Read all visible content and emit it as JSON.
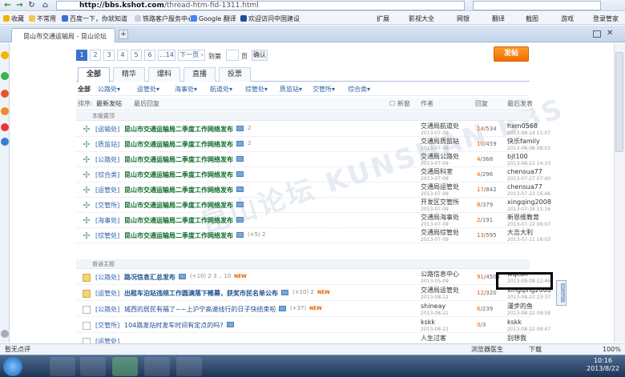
{
  "browser": {
    "url_host": "http://bbs.kshot.com",
    "url_path": "/thread-htm-fid-1311.html",
    "toolbar_right": [
      "扩展",
      "影视大全",
      "网银",
      "翻译",
      "截图",
      "游戏",
      "登录管家"
    ],
    "bookmarks": [
      "收藏",
      "不常用",
      "百度一下，你就知道",
      "铁路客户服务中心",
      "Google 翻译",
      "欢迎访问中国建设"
    ],
    "tab_title": "昆山市交通运输局 - 昆山论坛"
  },
  "pager": {
    "pages": [
      "1",
      "2",
      "3",
      "4",
      "5",
      "6",
      "...14",
      "下一页 ›"
    ],
    "goto_label": "到第",
    "page_suffix": "页",
    "confirm": "确认"
  },
  "post_button": "发帖",
  "tabs": [
    "全部",
    "精华",
    "爆料",
    "直播",
    "投票"
  ],
  "categories": [
    "全部",
    "公路处▾",
    "运管处▾",
    "海事处▾",
    "航道处▾",
    "综管处▾",
    "质监站▾",
    "交管所▾",
    "综合类▾"
  ],
  "list_header": {
    "sort": "排序:",
    "latest_post": "最新发帖",
    "latest_reply": "最后回复",
    "new_window": "新窗",
    "author": "作者",
    "replies": "回复",
    "last_post": "最后发表"
  },
  "sections": {
    "top": "本版置顶",
    "normal": "普通主题"
  },
  "rows": [
    {
      "forum": "[运输处]",
      "title": "昆山市交通运输局二季度工作网络发布",
      "extra": "2",
      "author": "交通局航道处",
      "adate": "2013-07-09",
      "rp": "14",
      "views": "/534",
      "last": "hxm0568",
      "ldate": "2013-08-14 15:07",
      "icon": "pin"
    },
    {
      "forum": "[质监站]",
      "title": "昆山市交通运输局二季度工作网络发布",
      "extra": "2",
      "author": "交通局质监站",
      "adate": "2013-07-09",
      "rp": "10",
      "views": "/459",
      "last": "快乐family",
      "ldate": "2013-08-08 08:01",
      "icon": "pin"
    },
    {
      "forum": "[公路处]",
      "title": "昆山市交通运输局二季度工作网络发布",
      "extra": "",
      "author": "交通局公路处",
      "adate": "2013-07-09",
      "rp": "4",
      "views": "/368",
      "last": "bjt100",
      "ldate": "2013-08-22 14:33",
      "icon": "pin"
    },
    {
      "forum": "[综合类]",
      "title": "昆山市交通运输局二季度工作网络发布",
      "extra": "",
      "author": "交通局科室",
      "adate": "2013-07-09",
      "rp": "4",
      "views": "/296",
      "last": "chensua77",
      "ldate": "2013-07-27 07:40",
      "icon": "pin"
    },
    {
      "forum": "[运管处]",
      "title": "昆山市交通运输局二季度工作网络发布",
      "extra": "",
      "author": "交通局运管处",
      "adate": "2013-07-09",
      "rp": "17",
      "views": "/842",
      "last": "chensua77",
      "ldate": "2013-07-23 16:46",
      "icon": "pin"
    },
    {
      "forum": "[交管所]",
      "title": "昆山市交通运输局二季度工作网络发布",
      "extra": "",
      "author": "开发区交管所",
      "adate": "2013-07-09",
      "rp": "8",
      "views": "/379",
      "last": "xingqing2008",
      "ldate": "2013-07-16 11:16",
      "icon": "pin"
    },
    {
      "forum": "[海事处]",
      "title": "昆山市交通运输局二季度工作网络发布",
      "extra": "",
      "author": "交通局海事处",
      "adate": "2013-07-09",
      "rp": "2",
      "views": "/191",
      "last": "新恩维教育",
      "ldate": "2013-07-12 08:07",
      "icon": "pin"
    },
    {
      "forum": "[综管处]",
      "title": "昆山市交通运输局二季度工作网络发布",
      "extra": "(+5)   2",
      "author": "交通局综管处",
      "adate": "2013-07-09",
      "rp": "13",
      "views": "/595",
      "last": "大吉大利",
      "ldate": "2013-07-11 16:03",
      "icon": "pin"
    },
    {
      "forum": "[公路处]",
      "title": "路况信息汇总发布",
      "extra": "(+10)   2 3 .. 10",
      "author": "公路信息中心",
      "adate": "2013-05-09",
      "rp": "91",
      "views": "/4504",
      "last": "wqcan",
      "ldate": "2013-09-08 12:46",
      "icon": "fold"
    },
    {
      "forum": "[运管处]",
      "title": "出租车泊站违规工作圆满落下帷幕，获奖市民名单公布",
      "extra": "(+10)   2",
      "author": "交通局运管处",
      "adate": "2013-08-12",
      "rp": "12",
      "views": "/320",
      "last": "xingqing2008",
      "ldate": "2013-08-23 23:37",
      "icon": "fold"
    },
    {
      "forum": "[公路处]",
      "title": "城西的居民有福了~~上沪宁高速线行的日子快结束啦",
      "extra": "(+37)",
      "author": "shineay",
      "adate": "2013-08-21",
      "rp": "6",
      "views": "/239",
      "last": "漫步的鱼",
      "ldate": "2013-08-22 09:58",
      "icon": "doc"
    },
    {
      "forum": "[交管所]",
      "title": "104路发站时发车时间有定点的吗?",
      "extra": "",
      "author": "kskk",
      "adate": "2013-08-22",
      "rp": "0",
      "views": "/3",
      "last": "kskk",
      "ldate": "2013-08-22 09:47",
      "icon": "doc"
    },
    {
      "forum": "[运管处]",
      "title": "",
      "extra": "",
      "author": "人生过客",
      "adate": "",
      "rp": "",
      "views": "",
      "last": "别想我",
      "ldate": "",
      "icon": "doc"
    }
  ],
  "status_left": "暂无点评",
  "status_right": [
    "浏览器医生",
    "下载",
    "100%"
  ],
  "sidetab": "回到顶部",
  "clock": {
    "time": "10:16",
    "date": "2013/8/22"
  },
  "watermark": "昆山论坛 KUNSHAN BBS"
}
